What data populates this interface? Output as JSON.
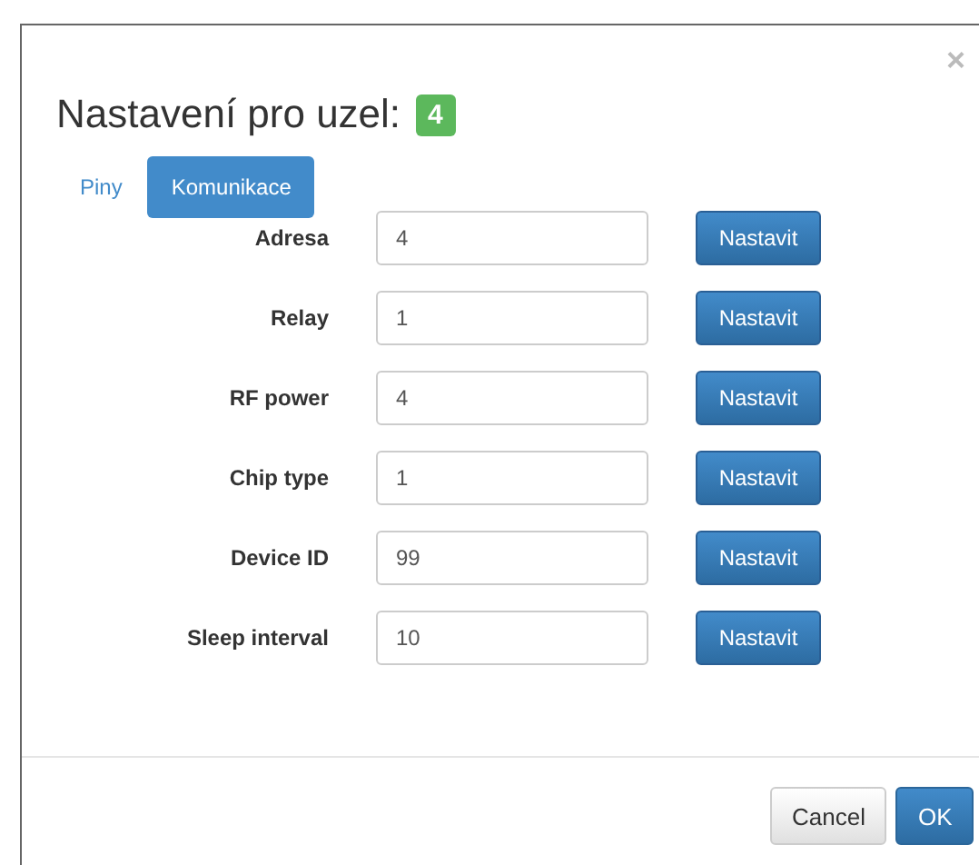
{
  "dialog": {
    "title": "Nastavení pro uzel:",
    "node_badge": "4",
    "close": "×"
  },
  "tabs": [
    {
      "label": "Piny",
      "selected": false
    },
    {
      "label": "Komunikace",
      "selected": true
    }
  ],
  "fields": [
    {
      "label": "Adresa",
      "value": "4",
      "button": "Nastavit"
    },
    {
      "label": "Relay",
      "value": "1",
      "button": "Nastavit"
    },
    {
      "label": "RF power",
      "value": "4",
      "button": "Nastavit"
    },
    {
      "label": "Chip type",
      "value": "1",
      "button": "Nastavit"
    },
    {
      "label": "Device ID",
      "value": "99",
      "button": "Nastavit"
    },
    {
      "label": "Sleep interval",
      "value": "10",
      "button": "Nastavit"
    }
  ],
  "footer_buttons": [
    {
      "label": "Cancel",
      "kind": "default"
    },
    {
      "label": "OK",
      "kind": "primary"
    }
  ]
}
